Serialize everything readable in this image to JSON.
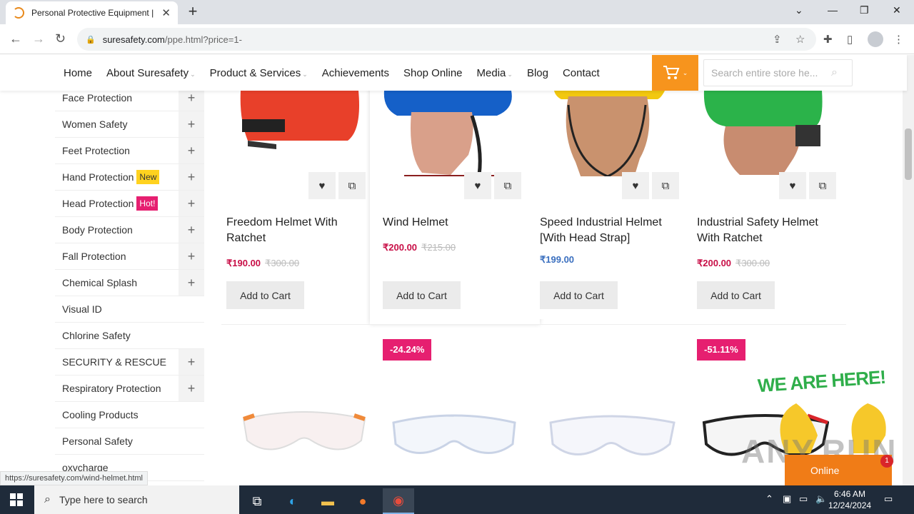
{
  "browser": {
    "tab_title": "Personal Protective Equipment |",
    "url_domain": "suresafety.com",
    "url_path": "/ppe.html?price=1-",
    "status_url": "https://suresafety.com/wind-helmet.html"
  },
  "nav": {
    "items": [
      "Home",
      "About Suresafety",
      "Product & Services",
      "Achievements",
      "Shop Online",
      "Media",
      "Blog",
      "Contact"
    ],
    "search_placeholder": "Search entire store he..."
  },
  "sidebar": {
    "categories": [
      {
        "label": "Face Protection",
        "expandable": true
      },
      {
        "label": "Women Safety",
        "expandable": true
      },
      {
        "label": "Feet Protection",
        "expandable": true
      },
      {
        "label": "Hand Protection",
        "badge": "New",
        "expandable": true
      },
      {
        "label": "Head Protection",
        "badge": "Hot!",
        "expandable": true
      },
      {
        "label": "Body Protection",
        "expandable": true
      },
      {
        "label": "Fall Protection",
        "expandable": true
      },
      {
        "label": "Chemical Splash",
        "expandable": true
      },
      {
        "label": "Visual ID",
        "expandable": false
      },
      {
        "label": "Chlorine Safety",
        "expandable": false
      },
      {
        "label": "SECURITY & RESCUE",
        "expandable": true
      },
      {
        "label": "Respiratory Protection",
        "expandable": true
      },
      {
        "label": "Cooling Products",
        "expandable": false
      },
      {
        "label": "Personal Safety",
        "expandable": false
      },
      {
        "label": "oxycharge",
        "expandable": false
      }
    ]
  },
  "products": [
    {
      "name_line1": "Freedom Helmet With",
      "name_line2": "Ratchet",
      "price": "₹190.00",
      "old_price": "₹300.00",
      "button": "Add to Cart",
      "helmet_color": "#e8402a"
    },
    {
      "name_line1": "Wind Helmet",
      "name_line2": "",
      "price": "₹200.00",
      "old_price": "₹215.00",
      "button": "Add to Cart",
      "helmet_color": "#1560c8"
    },
    {
      "name_line1": "Speed Industrial Helmet",
      "name_line2": "[With Head Strap]",
      "price": "₹199.00",
      "old_price": "",
      "button": "Add to Cart",
      "helmet_color": "#f2c80f"
    },
    {
      "name_line1": "Industrial Safety Helmet",
      "name_line2": "With Ratchet",
      "price": "₹200.00",
      "old_price": "₹300.00",
      "button": "Add to Cart",
      "helmet_color": "#2bb34a"
    }
  ],
  "row2": {
    "discounts": [
      "-24.24%",
      "-51.11%"
    ]
  },
  "chat_widget": {
    "headline": "WE ARE HERE!",
    "online_label": "Online",
    "notification_count": "1",
    "watermark": "ANY.RUN"
  },
  "taskbar": {
    "search_placeholder": "Type here to search",
    "time": "6:46 AM",
    "date": "12/24/2024"
  },
  "colors": {
    "accent_orange": "#f7941d",
    "price_red": "#c80f47",
    "badge_pink": "#e61f70",
    "badge_yellow": "#ffd21f"
  }
}
